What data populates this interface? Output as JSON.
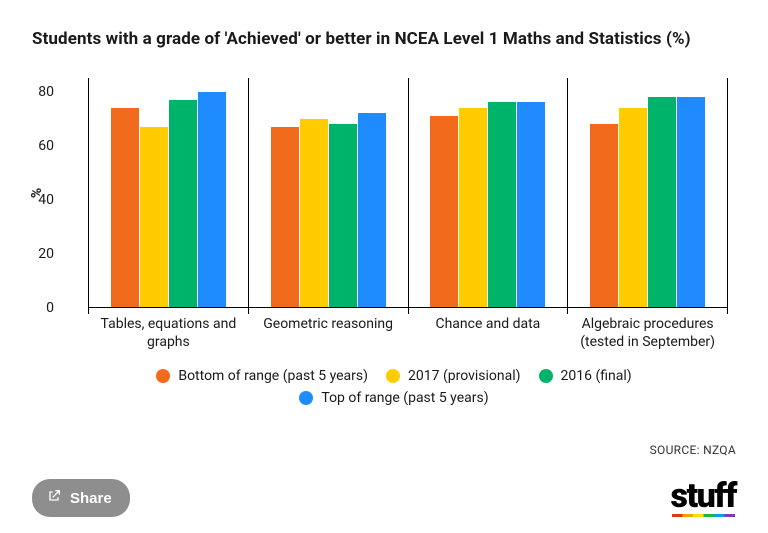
{
  "chart_data": {
    "type": "bar",
    "title": "Students with a grade of 'Achieved' or better in NCEA Level 1 Maths and Statistics (%)",
    "ylabel": "%",
    "ylim": [
      0,
      85
    ],
    "yticks": [
      0,
      20,
      40,
      60,
      80
    ],
    "categories": [
      "Tables, equations and graphs",
      "Geometric reasoning",
      "Chance and data",
      "Algebraic procedures (tested in September)"
    ],
    "series": [
      {
        "name": "Bottom of range (past 5 years)",
        "color": "#f26a1b",
        "values": [
          74,
          67,
          71,
          68
        ]
      },
      {
        "name": "2017 (provisional)",
        "color": "#ffcc00",
        "values": [
          67,
          70,
          74,
          74
        ]
      },
      {
        "name": "2016 (final)",
        "color": "#00b36b",
        "values": [
          77,
          68,
          76,
          78
        ]
      },
      {
        "name": "Top of range (past 5 years)",
        "color": "#1f8bff",
        "values": [
          80,
          72,
          76,
          78
        ]
      }
    ]
  },
  "source_prefix": "SOURCE: ",
  "source_name": "NZQA",
  "share_label": "Share",
  "brand": "stuff"
}
